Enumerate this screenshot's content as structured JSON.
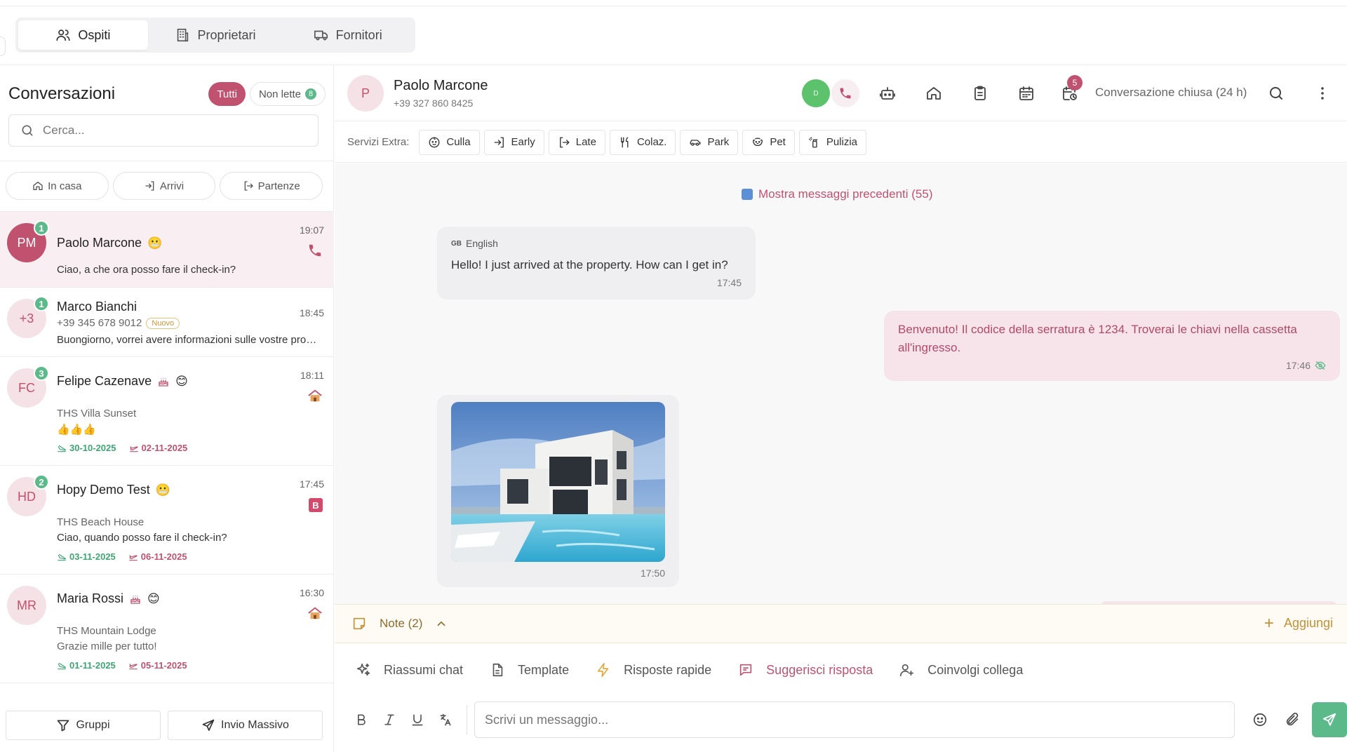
{
  "tabs": [
    {
      "label": "Ospiti",
      "icon": "users-icon",
      "active": true
    },
    {
      "label": "Proprietari",
      "icon": "building-icon",
      "active": false
    },
    {
      "label": "Fornitori",
      "icon": "truck-icon",
      "active": false
    }
  ],
  "sidebar": {
    "title": "Conversazioni",
    "filter_all": "Tutti",
    "filter_unread": "Non lette",
    "unread_count": "8",
    "search_placeholder": "Cerca...",
    "quick_filters": [
      {
        "label": "In casa",
        "icon": "home-icon"
      },
      {
        "label": "Arrivi",
        "icon": "login-icon"
      },
      {
        "label": "Partenze",
        "icon": "logout-icon"
      }
    ],
    "bottom": {
      "groups_label": "Gruppi",
      "bulk_label": "Invio Massivo"
    }
  },
  "conversations": [
    {
      "initials": "PM",
      "badge": "1",
      "name": "Paolo Marcone",
      "emoji": "😬",
      "time": "19:07",
      "preview": "Ciao, a che ora posso fare il check-in?",
      "status_icon": "phone-icon"
    },
    {
      "initials": "+3",
      "badge": "1",
      "name": "Marco Bianchi",
      "phone": "+39 345 678 9012",
      "tag": "Nuovo",
      "time": "18:45",
      "preview": "Buongiorno, vorrei avere informazioni sulle vostre proposte"
    },
    {
      "initials": "FC",
      "badge": "3",
      "name": "Felipe Cazenave",
      "emoji": "😊",
      "time": "18:11",
      "property": "THS Villa Sunset",
      "preview": "👍👍👍",
      "checkin": "30-10-2025",
      "checkout": "02-11-2025",
      "status_icon": "house-icon"
    },
    {
      "initials": "HD",
      "badge": "2",
      "name": "Hopy Demo Test",
      "emoji": "😬",
      "time": "17:45",
      "property": "THS Beach House",
      "preview": "Ciao, quando posso fare il check-in?",
      "checkin": "03-11-2025",
      "checkout": "06-11-2025",
      "status_icon": "booking-icon",
      "status_text": "B"
    },
    {
      "initials": "MR",
      "name": "Maria Rossi",
      "emoji": "😊",
      "time": "16:30",
      "property": "THS Mountain Lodge",
      "preview": "Grazie mille per tutto!",
      "checkin": "01-11-2025",
      "checkout": "05-11-2025",
      "status_icon": "house-icon"
    }
  ],
  "chat": {
    "avatar": "P",
    "name": "Paolo Marcone",
    "phone": "+39 327 860 8425",
    "status_label": "D",
    "notif_count": "5",
    "closed_label": "Conversazione chiusa (24 h)",
    "extras_label": "Servizi Extra:",
    "extras": [
      {
        "label": "Culla",
        "icon": "crib-icon"
      },
      {
        "label": "Early",
        "icon": "login-icon"
      },
      {
        "label": "Late",
        "icon": "logout-icon"
      },
      {
        "label": "Colaz.",
        "icon": "utensils-icon"
      },
      {
        "label": "Park",
        "icon": "car-icon"
      },
      {
        "label": "Pet",
        "icon": "paw-icon"
      },
      {
        "label": "Pulizia",
        "icon": "spray-icon"
      }
    ],
    "prev_messages": "Mostra messaggi precedenti (55)",
    "messages": [
      {
        "dir": "in",
        "lang_flag": "GB",
        "lang": "English",
        "text": "Hello! I just arrived at the property. How can I get in?",
        "time": "17:45"
      },
      {
        "dir": "out",
        "text": "Benvenuto! Il codice della serratura è 1234. Troverai le chiavi nella cassetta all'ingresso.",
        "time": "17:46"
      },
      {
        "dir": "in",
        "type": "image",
        "time": "17:50"
      }
    ],
    "notes_label": "Note (2)",
    "notes_add": "Aggiungi",
    "actions": [
      {
        "label": "Riassumi chat",
        "icon": "sparkles-icon"
      },
      {
        "label": "Template",
        "icon": "file-icon"
      },
      {
        "label": "Risposte rapide",
        "icon": "bolt-icon"
      },
      {
        "label": "Suggerisci risposta",
        "icon": "message-icon",
        "highlight": true
      },
      {
        "label": "Coinvolgi collega",
        "icon": "user-plus-icon"
      }
    ],
    "input_placeholder": "Scrivi un messaggio..."
  },
  "colors": {
    "accent": "#c0526f",
    "success": "#5bb98a",
    "note": "#c49138"
  }
}
